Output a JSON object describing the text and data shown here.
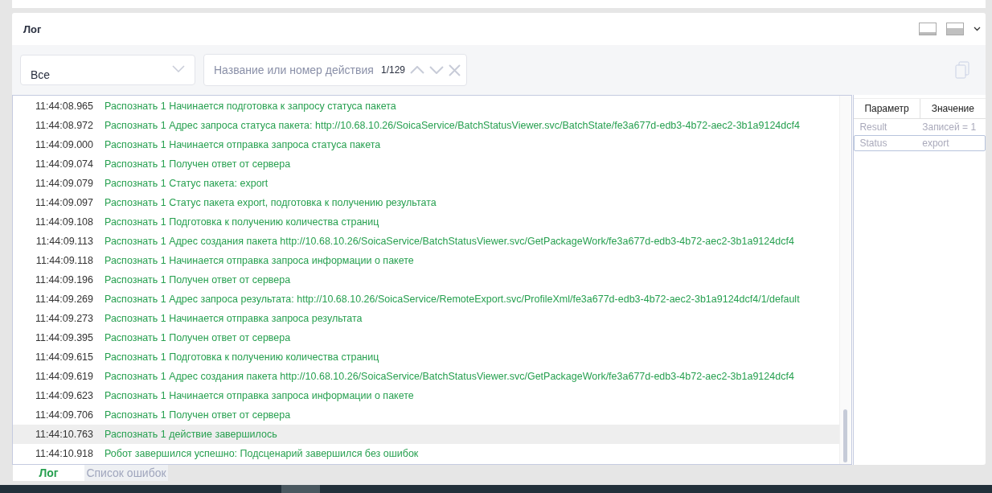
{
  "panel": {
    "title": "Лог"
  },
  "filter": {
    "level": "Все",
    "search_placeholder": "Название или номер действия",
    "counter": "1/129"
  },
  "log": [
    {
      "time": "11:44:08.965",
      "message": "Распознать 1 Начинается подготовка к запросу статуса пакета",
      "selected": false
    },
    {
      "time": "11:44:08.972",
      "message": "Распознать 1 Адрес запроса статуса пакета: http://10.68.10.26/SoicaService/BatchStatusViewer.svc/BatchState/fe3a677d-edb3-4b72-aec2-3b1a9124dcf4",
      "selected": false
    },
    {
      "time": "11:44:09.000",
      "message": "Распознать 1 Начинается отправка запроса статуса пакета",
      "selected": false
    },
    {
      "time": "11:44:09.074",
      "message": "Распознать 1 Получен ответ от сервера",
      "selected": false
    },
    {
      "time": "11:44:09.079",
      "message": "Распознать 1 Статус пакета: export",
      "selected": false
    },
    {
      "time": "11:44:09.097",
      "message": "Распознать 1 Статус пакета export, подготовка к получению результата",
      "selected": false
    },
    {
      "time": "11:44:09.108",
      "message": "Распознать 1 Подготовка к получению количества страниц",
      "selected": false
    },
    {
      "time": "11:44:09.113",
      "message": "Распознать 1 Адрес создания пакета http://10.68.10.26/SoicaService/BatchStatusViewer.svc/GetPackageWork/fe3a677d-edb3-4b72-aec2-3b1a9124dcf4",
      "selected": false
    },
    {
      "time": "11:44:09.118",
      "message": "Распознать 1 Начинается отправка запроса информации о пакете",
      "selected": false
    },
    {
      "time": "11:44:09.196",
      "message": "Распознать 1 Получен ответ от сервера",
      "selected": false
    },
    {
      "time": "11:44:09.269",
      "message": "Распознать 1 Адрес запроса результата: http://10.68.10.26/SoicaService/RemoteExport.svc/ProfileXml/fe3a677d-edb3-4b72-aec2-3b1a9124dcf4/1/default",
      "selected": false
    },
    {
      "time": "11:44:09.273",
      "message": "Распознать 1 Начинается отправка запроса результата",
      "selected": false
    },
    {
      "time": "11:44:09.395",
      "message": "Распознать 1 Получен ответ от сервера",
      "selected": false
    },
    {
      "time": "11:44:09.615",
      "message": "Распознать 1 Подготовка к получению количества страниц",
      "selected": false
    },
    {
      "time": "11:44:09.619",
      "message": "Распознать 1 Адрес создания пакета http://10.68.10.26/SoicaService/BatchStatusViewer.svc/GetPackageWork/fe3a677d-edb3-4b72-aec2-3b1a9124dcf4",
      "selected": false
    },
    {
      "time": "11:44:09.623",
      "message": "Распознать 1 Начинается отправка запроса информации о пакете",
      "selected": false
    },
    {
      "time": "11:44:09.706",
      "message": "Распознать 1 Получен ответ от сервера",
      "selected": false
    },
    {
      "time": "11:44:10.763",
      "message": "Распознать 1 действие завершилось",
      "selected": true
    },
    {
      "time": "11:44:10.918",
      "message": "Робот завершился успешно: Подсценарий завершился без ошибок",
      "selected": false
    }
  ],
  "params": {
    "columns": [
      "Параметр",
      "Значение"
    ],
    "rows": [
      {
        "name": "Result",
        "value": "Записей = 1",
        "selected": false
      },
      {
        "name": "Status",
        "value": "export",
        "selected": true
      }
    ]
  },
  "tabs": [
    {
      "label": "Лог",
      "selected": true
    },
    {
      "label": "Список ошибок",
      "selected": false
    }
  ]
}
